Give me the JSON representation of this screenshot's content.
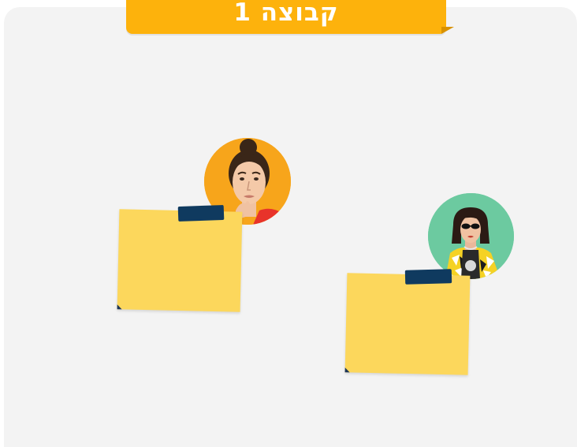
{
  "header": {
    "group_title": "קבוצה 1"
  },
  "colors": {
    "board_background": "#f3f3f3",
    "banner": "#fdb20c",
    "sticky_note": "#fcd75c",
    "tape": "#0f3a5f",
    "avatar_1_background": "#f7a51b",
    "avatar_2_background": "#6ccaa0"
  },
  "participants": [
    {
      "avatar": "woman-with-hair-bun-photo",
      "note_text": ""
    },
    {
      "avatar": "woman-with-sunglasses-photo",
      "note_text": ""
    }
  ]
}
